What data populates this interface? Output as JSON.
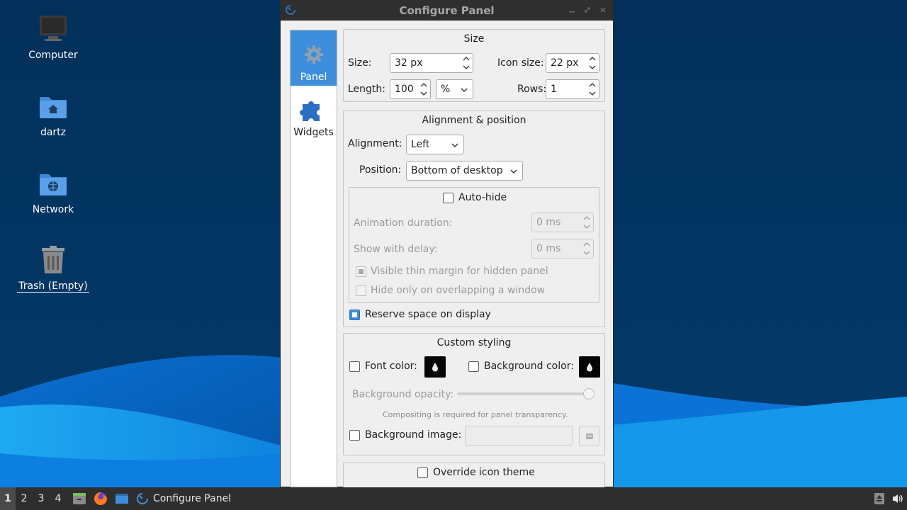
{
  "desktop": {
    "icons": [
      {
        "label": "Computer"
      },
      {
        "label": "dartz"
      },
      {
        "label": "Network"
      },
      {
        "label": "Trash (Empty)"
      }
    ]
  },
  "window": {
    "title": "Configure Panel",
    "sidebar": {
      "items": [
        {
          "label": "Panel",
          "icon": "gear-icon",
          "active": true
        },
        {
          "label": "Widgets",
          "icon": "puzzle-icon",
          "active": false
        }
      ]
    },
    "size_group": {
      "title": "Size",
      "size_label": "Size:",
      "size_value": "32 px",
      "icon_size_label": "Icon size:",
      "icon_size_value": "22 px",
      "length_label": "Length:",
      "length_value": "100",
      "length_unit": "%",
      "rows_label": "Rows:",
      "rows_value": "1"
    },
    "alignment_group": {
      "title": "Alignment & position",
      "alignment_label": "Alignment:",
      "alignment_value": "Left",
      "position_label": "Position:",
      "position_value": "Bottom of desktop",
      "autohide_label": "Auto-hide",
      "animation_label": "Animation duration:",
      "animation_value": "0 ms",
      "delay_label": "Show with delay:",
      "delay_value": "0 ms",
      "thin_margin_label": "Visible thin margin for hidden panel",
      "overlap_label": "Hide only on overlapping a window",
      "reserve_label": "Reserve space on display"
    },
    "styling_group": {
      "title": "Custom styling",
      "font_color_label": "Font color:",
      "bg_color_label": "Background color:",
      "opacity_label": "Background opacity:",
      "opacity_value": 100,
      "compositing_note": "Compositing is required for panel transparency.",
      "bg_image_label": "Background image:",
      "bg_image_value": ""
    },
    "override_label": "Override icon theme"
  },
  "taskbar": {
    "workspaces": [
      "1",
      "2",
      "3",
      "4"
    ],
    "active_workspace": "1",
    "task_title": "Configure Panel"
  },
  "colors": {
    "accent": "#3d8fde",
    "wallpaper_dark": "#02305a",
    "wallpaper_light": "#1aa3f0",
    "taskbar": "#2e2e2e",
    "titlebar": "#2f2f2f"
  }
}
